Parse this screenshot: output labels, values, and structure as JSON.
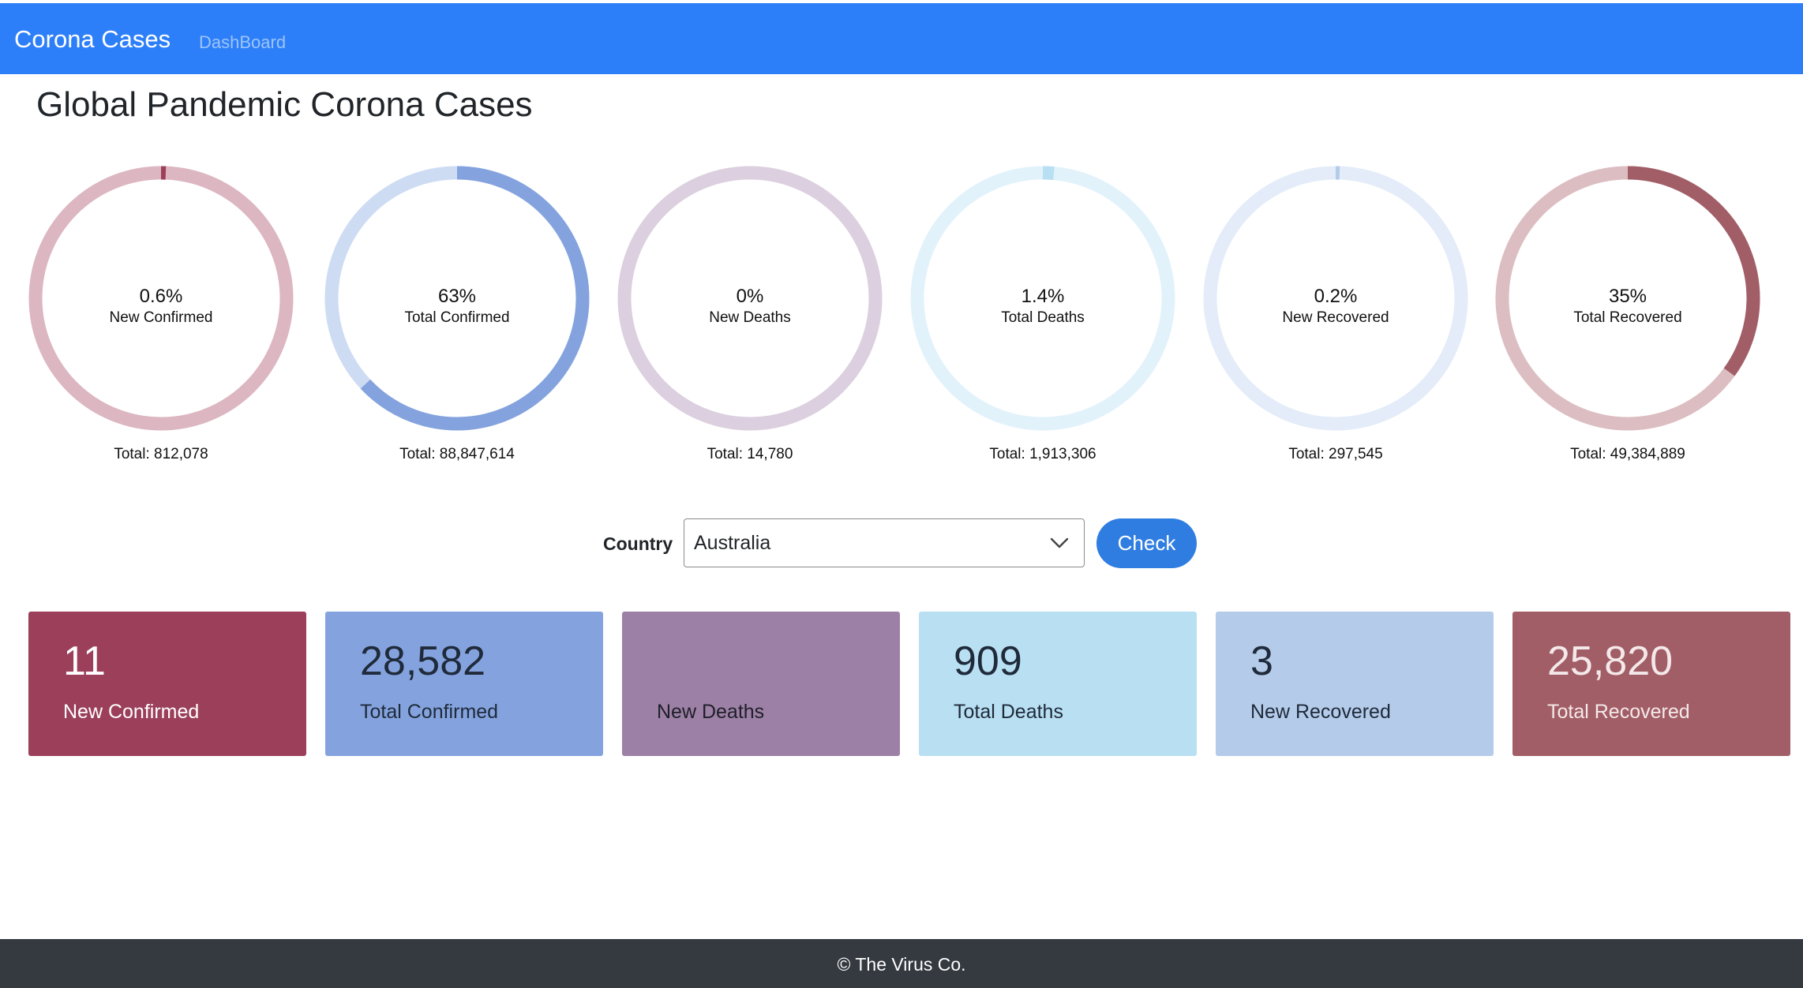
{
  "navbar": {
    "brand": "Corona Cases",
    "link": "DashBoard",
    "color": "#2d7ff9"
  },
  "page_title": "Global Pandemic Corona Cases",
  "rings": [
    {
      "percent_label": "0.6%",
      "percent": 0.6,
      "name": "New Confirmed",
      "total": "Total: 812,078",
      "track_color": "#dcb6c1",
      "arc_color": "#9b3f5a"
    },
    {
      "percent_label": "63%",
      "percent": 63,
      "name": "Total Confirmed",
      "total": "Total: 88,847,614",
      "track_color": "#cddcf3",
      "arc_color": "#84a3de"
    },
    {
      "percent_label": "0%",
      "percent": 0,
      "name": "New Deaths",
      "total": "Total: 14,780",
      "track_color": "#dccfdf",
      "arc_color": "#9d80a5"
    },
    {
      "percent_label": "1.4%",
      "percent": 1.4,
      "name": "Total Deaths",
      "total": "Total: 1,913,306",
      "track_color": "#e2f2fb",
      "arc_color": "#b8e0f2"
    },
    {
      "percent_label": "0.2%",
      "percent": 0.2,
      "name": "New Recovered",
      "total": "Total: 297,545",
      "track_color": "#e3ecf8",
      "arc_color": "#b4cbea"
    },
    {
      "percent_label": "35%",
      "percent": 35,
      "name": "Total Recovered",
      "total": "Total: 49,384,889",
      "track_color": "#dcbec2",
      "arc_color": "#a25e66"
    }
  ],
  "country_form": {
    "label": "Country",
    "selected": "Australia",
    "button_label": "Check",
    "button_color": "#2f7de1"
  },
  "cards": [
    {
      "value": "11",
      "label": "New Confirmed",
      "bg": "#9b3f5a",
      "fg": "#ffffff"
    },
    {
      "value": "28,582",
      "label": "Total Confirmed",
      "bg": "#84a3de",
      "fg": "#1f2a3a"
    },
    {
      "value": "",
      "label": "New Deaths",
      "bg": "#9d80a5",
      "fg": "#1f1f2a"
    },
    {
      "value": "909",
      "label": "Total Deaths",
      "bg": "#b8e0f2",
      "fg": "#1f2a3a"
    },
    {
      "value": "3",
      "label": "New Recovered",
      "bg": "#b4cbea",
      "fg": "#1f2a3a"
    },
    {
      "value": "25,820",
      "label": "Total Recovered",
      "bg": "#a25e66",
      "fg": "#f4e9ea"
    }
  ],
  "footer": {
    "text": "© The Virus Co.",
    "bg": "#343a40"
  }
}
